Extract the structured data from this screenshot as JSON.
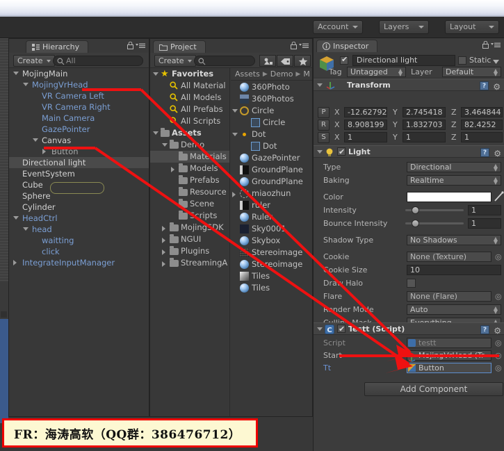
{
  "toolbar": {
    "cloud_icon": "cloud-icon",
    "account": "Account",
    "layers": "Layers",
    "layout": "Layout"
  },
  "hierarchy": {
    "tab": "Hierarchy",
    "create": "Create",
    "search_placeholder": "All",
    "items": [
      {
        "label": "MojingMain",
        "depth": 0,
        "tri": "open",
        "color": "wht"
      },
      {
        "label": "MojingVrHead",
        "depth": 1,
        "tri": "open",
        "color": "blu"
      },
      {
        "label": "VR Camera Left",
        "depth": 2,
        "tri": "none",
        "color": "blu"
      },
      {
        "label": "VR Camera Right",
        "depth": 2,
        "tri": "none",
        "color": "blu"
      },
      {
        "label": "Main Camera",
        "depth": 2,
        "tri": "none",
        "color": "blu"
      },
      {
        "label": "GazePointer",
        "depth": 2,
        "tri": "none",
        "color": "blu"
      },
      {
        "label": "Canvas",
        "depth": 2,
        "tri": "open",
        "color": "wht"
      },
      {
        "label": "Button",
        "depth": 3,
        "tri": "closed",
        "color": "gry"
      },
      {
        "label": "Directional light",
        "depth": 0,
        "tri": "none",
        "color": "wht",
        "selected": true
      },
      {
        "label": "EventSystem",
        "depth": 0,
        "tri": "none",
        "color": "wht"
      },
      {
        "label": "Cube",
        "depth": 0,
        "tri": "none",
        "color": "wht"
      },
      {
        "label": "Sphere",
        "depth": 0,
        "tri": "none",
        "color": "wht"
      },
      {
        "label": "Cylinder",
        "depth": 0,
        "tri": "none",
        "color": "wht"
      },
      {
        "label": "HeadCtrl",
        "depth": 0,
        "tri": "open",
        "color": "blu"
      },
      {
        "label": "head",
        "depth": 1,
        "tri": "open",
        "color": "blu"
      },
      {
        "label": "waitting",
        "depth": 2,
        "tri": "none",
        "color": "blu"
      },
      {
        "label": "click",
        "depth": 2,
        "tri": "none",
        "color": "blu"
      },
      {
        "label": "IntegrateInputManager",
        "depth": 0,
        "tri": "closed",
        "color": "blu"
      }
    ]
  },
  "project": {
    "tab": "Project",
    "create": "Create",
    "search_placeholder": "",
    "icon_buttons": [
      "avatar-filter-icon",
      "label-filter-icon",
      "favorite-star-icon"
    ],
    "breadcrumb": [
      "Assets",
      "Demo",
      "M"
    ],
    "tree": [
      {
        "label": "Favorites",
        "depth": 0,
        "tri": "open",
        "icon": "star-icon",
        "bold": true
      },
      {
        "label": "All Material",
        "depth": 1,
        "tri": "none",
        "icon": "search-icon"
      },
      {
        "label": "All Models",
        "depth": 1,
        "tri": "none",
        "icon": "search-icon"
      },
      {
        "label": "All Prefabs",
        "depth": 1,
        "tri": "none",
        "icon": "search-icon"
      },
      {
        "label": "All Scripts",
        "depth": 1,
        "tri": "none",
        "icon": "search-icon"
      },
      {
        "label": "Assets",
        "depth": 0,
        "tri": "open",
        "icon": "folder-icon",
        "bold": true
      },
      {
        "label": "Demo",
        "depth": 1,
        "tri": "open",
        "icon": "folder-icon"
      },
      {
        "label": "Materials",
        "depth": 2,
        "tri": "none",
        "icon": "folder-icon",
        "selected": true
      },
      {
        "label": "Models",
        "depth": 2,
        "tri": "closed",
        "icon": "folder-icon"
      },
      {
        "label": "Prefabs",
        "depth": 2,
        "tri": "none",
        "icon": "folder-icon"
      },
      {
        "label": "Resource",
        "depth": 2,
        "tri": "none",
        "icon": "folder-icon"
      },
      {
        "label": "Scene",
        "depth": 2,
        "tri": "none",
        "icon": "folder-icon"
      },
      {
        "label": "Scripts",
        "depth": 2,
        "tri": "none",
        "icon": "folder-icon"
      },
      {
        "label": "MojingSDK",
        "depth": 1,
        "tri": "closed",
        "icon": "folder-icon"
      },
      {
        "label": "NGUI",
        "depth": 1,
        "tri": "closed",
        "icon": "folder-icon"
      },
      {
        "label": "Plugins",
        "depth": 1,
        "tri": "closed",
        "icon": "folder-icon"
      },
      {
        "label": "StreamingA",
        "depth": 1,
        "tri": "closed",
        "icon": "folder-icon"
      }
    ],
    "assets": [
      {
        "label": "360Photo",
        "icon": "material-sphere-icon",
        "depth": 0,
        "tri": "none"
      },
      {
        "label": "360Photos",
        "icon": "texture-icon",
        "depth": 0,
        "tri": "none"
      },
      {
        "label": "Circle",
        "icon": "circle-outline-icon",
        "depth": 0,
        "tri": "open"
      },
      {
        "label": "Circle",
        "icon": "prefab-icon",
        "depth": 1,
        "tri": "none"
      },
      {
        "label": "Dot",
        "icon": "dot-icon",
        "depth": 0,
        "tri": "open"
      },
      {
        "label": "Dot",
        "icon": "prefab-icon",
        "depth": 1,
        "tri": "none"
      },
      {
        "label": "GazePointer",
        "icon": "material-sphere-icon",
        "depth": 0,
        "tri": "none"
      },
      {
        "label": "GroundPlane",
        "icon": "texture-dark-icon",
        "depth": 0,
        "tri": "none"
      },
      {
        "label": "GroundPlane",
        "icon": "material-sphere-icon",
        "depth": 0,
        "tri": "none"
      },
      {
        "label": "miaozhun",
        "icon": "model-icon",
        "depth": 0,
        "tri": "closed"
      },
      {
        "label": "ruler",
        "icon": "texture-dark-icon",
        "depth": 0,
        "tri": "none"
      },
      {
        "label": "Ruler",
        "icon": "material-sphere-icon",
        "depth": 0,
        "tri": "none"
      },
      {
        "label": "Sky0001",
        "icon": "texture-sky-icon",
        "depth": 0,
        "tri": "none"
      },
      {
        "label": "Skybox",
        "icon": "material-sphere-icon",
        "depth": 0,
        "tri": "none"
      },
      {
        "label": "Stereoimage",
        "icon": "texture-noise-icon",
        "depth": 0,
        "tri": "none"
      },
      {
        "label": "Stereoimage",
        "icon": "material-sphere-icon",
        "depth": 0,
        "tri": "none"
      },
      {
        "label": "Tiles",
        "icon": "texture-tiles-icon",
        "depth": 0,
        "tri": "none"
      },
      {
        "label": "Tiles",
        "icon": "material-sphere-icon",
        "depth": 0,
        "tri": "none"
      }
    ]
  },
  "inspector": {
    "tab": "Inspector",
    "object_name": "Directional light",
    "enabled": true,
    "static_label": "Static",
    "tag_label": "Tag",
    "tag_value": "Untagged",
    "layer_label": "Layer",
    "layer_value": "Default",
    "transform": {
      "title": "Transform",
      "rows": [
        {
          "key": "P",
          "x": "-12.62792",
          "y": "2.745418",
          "z": "3.464844"
        },
        {
          "key": "R",
          "x": "8.908199",
          "y": "1.832703",
          "z": "82.4252"
        },
        {
          "key": "S",
          "x": "1",
          "y": "1",
          "z": "1"
        }
      ],
      "axis_labels": [
        "X",
        "Y",
        "Z"
      ]
    },
    "light": {
      "title": "Light",
      "enabled": true,
      "fields": [
        {
          "label": "Type",
          "value": "Directional",
          "kind": "dropdown"
        },
        {
          "label": "Baking",
          "value": "Realtime",
          "kind": "dropdown"
        },
        {
          "label": "Color",
          "value": "#FFFFFF",
          "kind": "color"
        },
        {
          "label": "Intensity",
          "value": "1",
          "kind": "slider"
        },
        {
          "label": "Bounce Intensity",
          "value": "1",
          "kind": "slider"
        },
        {
          "label": "Shadow Type",
          "value": "No Shadows",
          "kind": "dropdown"
        },
        {
          "label": "Cookie",
          "value": "None (Texture)",
          "kind": "object"
        },
        {
          "label": "Cookie Size",
          "value": "10",
          "kind": "number"
        },
        {
          "label": "Draw Halo",
          "value": "",
          "kind": "checkbox"
        },
        {
          "label": "Flare",
          "value": "None (Flare)",
          "kind": "object"
        },
        {
          "label": "Render Mode",
          "value": "Auto",
          "kind": "dropdown"
        },
        {
          "label": "Culling Mask",
          "value": "Everything",
          "kind": "dropdown"
        }
      ]
    },
    "script_component": {
      "title": "Testt (Script)",
      "enabled": true,
      "fields": [
        {
          "label": "Script",
          "value": "testt",
          "kind": "script"
        },
        {
          "label": "Start",
          "value": "MojingVrHead (Tr",
          "kind": "object"
        },
        {
          "label": "Tt",
          "value": "Button",
          "kind": "object",
          "highlighted": true
        }
      ]
    },
    "add_component": "Add Component"
  },
  "watermark": {
    "text": "FR：海涛高软（QQ群：386476712）",
    "border_color": "#ee0000",
    "background_color": "#fdf8d2"
  },
  "annotations": {
    "color": "#ee0000",
    "arrow_count": 2
  }
}
